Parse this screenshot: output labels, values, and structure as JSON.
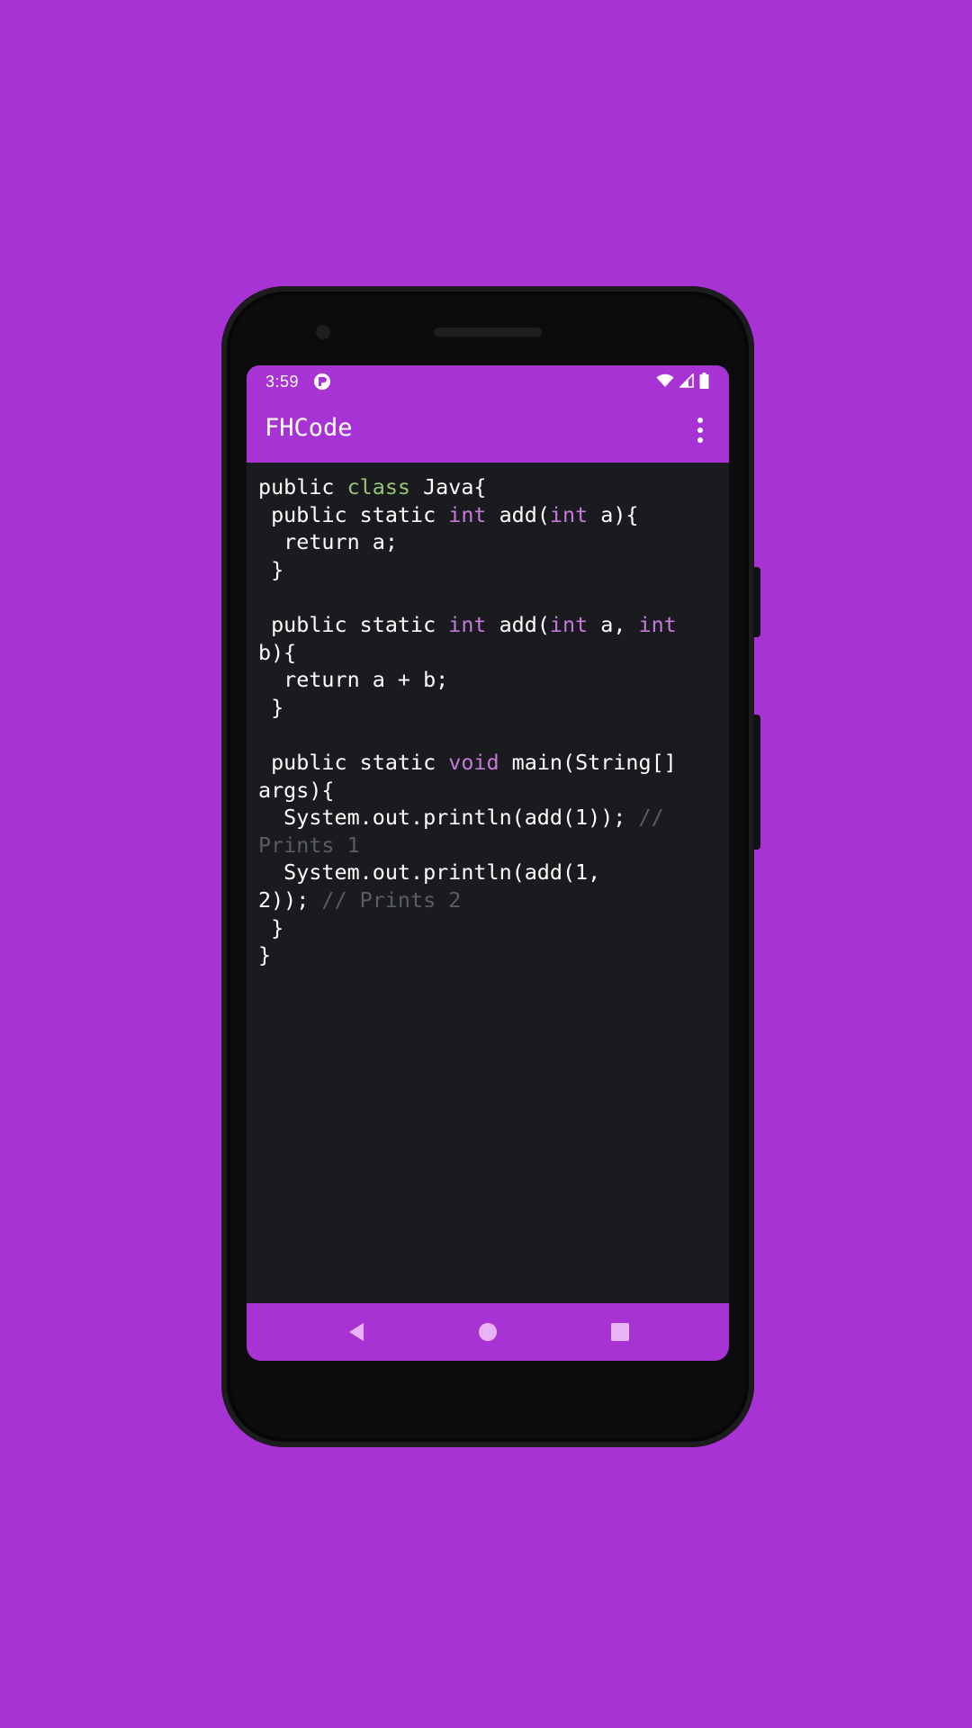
{
  "status_bar": {
    "time": "3:59",
    "app_icon": "fhcode-notification-icon",
    "wifi_icon": "wifi-icon",
    "signal_icon": "cell-signal-icon",
    "battery_icon": "battery-icon"
  },
  "app_bar": {
    "title": "FHCode",
    "overflow_icon": "more-vertical-icon"
  },
  "code_lines": [
    [
      {
        "t": "public ",
        "c": ""
      },
      {
        "t": "class",
        "c": "kw-class"
      },
      {
        "t": " Java{",
        "c": ""
      }
    ],
    [
      {
        "t": " public static ",
        "c": ""
      },
      {
        "t": "int",
        "c": "kw-type"
      },
      {
        "t": " add(",
        "c": ""
      },
      {
        "t": "int",
        "c": "kw-type"
      },
      {
        "t": " a){",
        "c": ""
      }
    ],
    [
      {
        "t": "  return a;",
        "c": ""
      }
    ],
    [
      {
        "t": " }",
        "c": ""
      }
    ],
    [
      {
        "t": "",
        "c": ""
      }
    ],
    [
      {
        "t": " public static ",
        "c": ""
      },
      {
        "t": "int",
        "c": "kw-type"
      },
      {
        "t": " add(",
        "c": ""
      },
      {
        "t": "int",
        "c": "kw-type"
      },
      {
        "t": " a, ",
        "c": ""
      },
      {
        "t": "int",
        "c": "kw-type"
      }
    ],
    [
      {
        "t": "b){",
        "c": ""
      }
    ],
    [
      {
        "t": "  return a + b;",
        "c": ""
      }
    ],
    [
      {
        "t": " }",
        "c": ""
      }
    ],
    [
      {
        "t": "",
        "c": ""
      }
    ],
    [
      {
        "t": " public static ",
        "c": ""
      },
      {
        "t": "void",
        "c": "kw-type"
      },
      {
        "t": " main(String[]",
        "c": ""
      }
    ],
    [
      {
        "t": "args){",
        "c": ""
      }
    ],
    [
      {
        "t": "  System.out.println(add(1)); ",
        "c": ""
      },
      {
        "t": "//",
        "c": "cm"
      }
    ],
    [
      {
        "t": "Prints 1",
        "c": "cm"
      }
    ],
    [
      {
        "t": "  System.out.println(add(1,",
        "c": ""
      }
    ],
    [
      {
        "t": "2)); ",
        "c": ""
      },
      {
        "t": "// Prints 2",
        "c": "cm"
      }
    ],
    [
      {
        "t": " }",
        "c": ""
      }
    ],
    [
      {
        "t": "}",
        "c": ""
      }
    ]
  ],
  "nav_bar": {
    "back_icon": "back-triangle-icon",
    "home_icon": "home-circle-icon",
    "recents_icon": "recents-square-icon"
  },
  "colors": {
    "background": "#a833d4",
    "editor_background": "#1a1b1e",
    "keyword_class": "#98c379",
    "keyword_type": "#c678dd",
    "comment": "#5a5c63"
  }
}
